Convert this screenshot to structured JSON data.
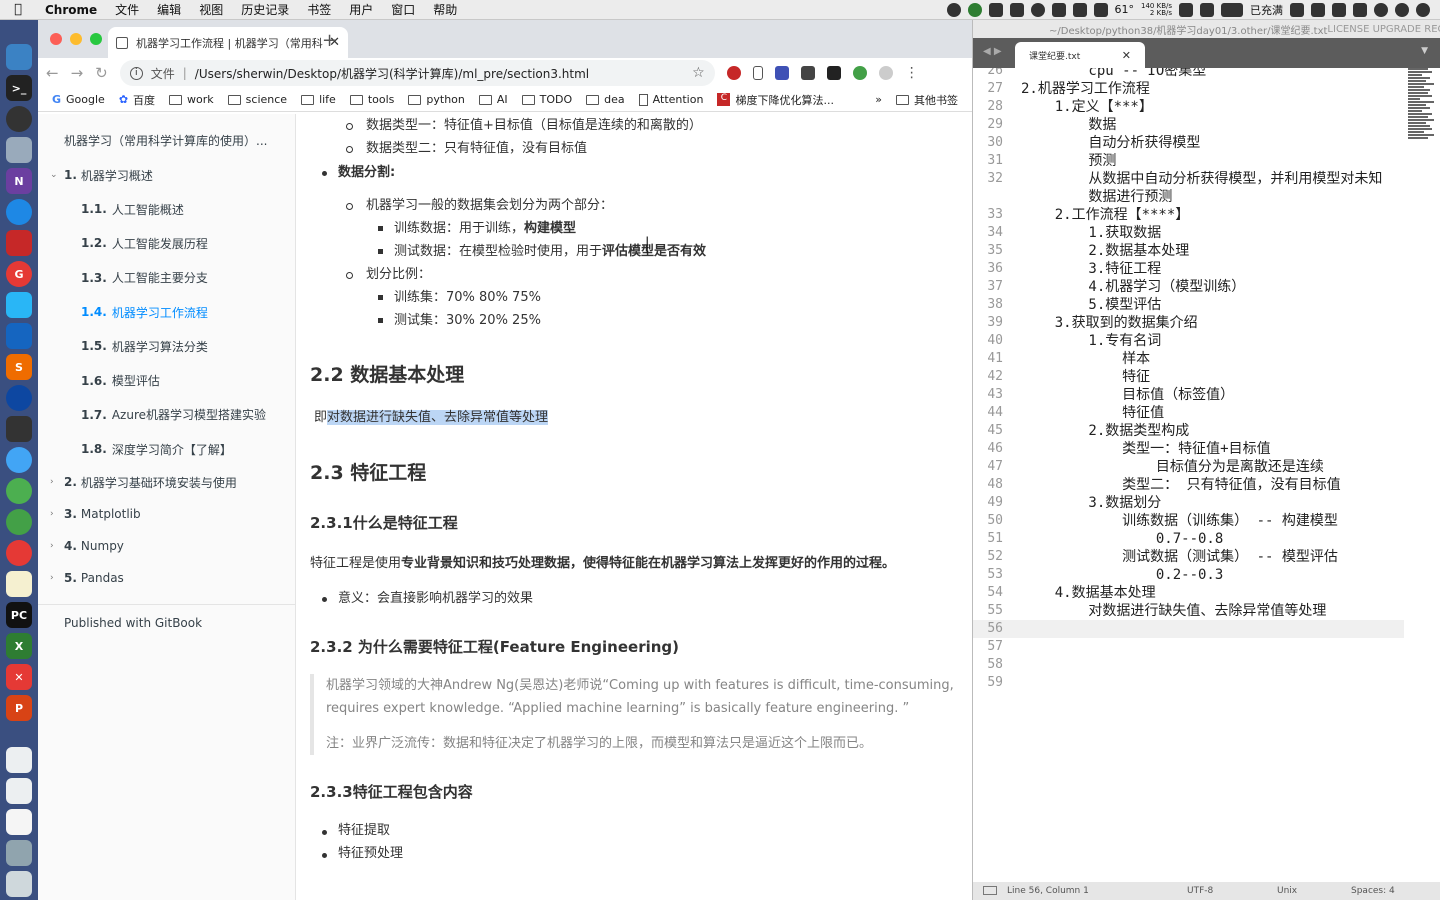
{
  "menubar": {
    "app": "Chrome",
    "items": [
      "文件",
      "编辑",
      "视图",
      "历史记录",
      "书签",
      "用户",
      "窗口",
      "帮助"
    ],
    "temp": "61°",
    "net_up": "140 KB/s",
    "net_down": "2 KB/s",
    "battery": "已充满"
  },
  "browser": {
    "tab_title": "机器学习工作流程 | 机器学习（常用科学计算库的使用）",
    "scheme_label": "文件",
    "url": "/Users/sherwin/Desktop/机器学习(科学计算库)/ml_pre/section3.html",
    "bookmarks": [
      "Google",
      "百度",
      "work",
      "science",
      "life",
      "tools",
      "python",
      "AI",
      "TODO",
      "dea",
      "Attention",
      "梯度下降优化算法..."
    ],
    "bookmarks_more": "»",
    "other_bookmarks": "其他书签"
  },
  "sidebar": {
    "book_title": "机器学习（常用科学计算库的使用）...",
    "chapter1": {
      "num": "1.",
      "label": "机器学习概述"
    },
    "subs": [
      {
        "num": "1.1.",
        "label": "人工智能概述"
      },
      {
        "num": "1.2.",
        "label": "人工智能发展历程"
      },
      {
        "num": "1.3.",
        "label": "人工智能主要分支"
      },
      {
        "num": "1.4.",
        "label": "机器学习工作流程"
      },
      {
        "num": "1.5.",
        "label": "机器学习算法分类"
      },
      {
        "num": "1.6.",
        "label": "模型评估"
      },
      {
        "num": "1.7.",
        "label": "Azure机器学习模型搭建实验"
      },
      {
        "num": "1.8.",
        "label": "深度学习简介【了解】"
      }
    ],
    "chapters": [
      {
        "num": "2.",
        "label": "机器学习基础环境安装与使用"
      },
      {
        "num": "3.",
        "label": "Matplotlib"
      },
      {
        "num": "4.",
        "label": "Numpy"
      },
      {
        "num": "5.",
        "label": "Pandas"
      }
    ],
    "published": "Published with GitBook"
  },
  "content": {
    "type1": "数据类型一：特征值+目标值（目标值是连续的和离散的）",
    "type2": "数据类型二：只有特征值，没有目标值",
    "split_title": "数据分割:",
    "split_desc": "机器学习一般的数据集会划分为两个部分：",
    "train_prefix": "训练数据：用于训练，",
    "train_bold": "构建模型",
    "test_prefix": "测试数据：在模型检验时使用，用于",
    "test_bold": "评估模型是否有效",
    "ratio_title": "划分比例：",
    "train_ratio": "训练集：70% 80% 75%",
    "test_ratio": "测试集：30% 20% 25%",
    "h_22": "2.2 数据基本处理",
    "p_22_prefix": "即",
    "p_22_hl": "对数据进行缺失值、去除异常值等处理",
    "h_23": "2.3 特征工程",
    "h_231": "2.3.1什么是特征工程",
    "fe_prefix": "特征工程是使用",
    "fe_bold": "专业背景知识和技巧处理数据，使得特征能在机器学习算法上发挥更好的作用的过程。",
    "meaning": "意义：会直接影响机器学习的效果",
    "h_232": "2.3.2 为什么需要特征工程(Feature Engineering)",
    "quote1": "机器学习领域的大神Andrew Ng(吴恩达)老师说“Coming up with features is difficult, time-consuming, requires expert knowledge. “Applied machine learning” is basically feature engineering. ”",
    "quote2": "注：业界广泛流传：数据和特征决定了机器学习的上限，而模型和算法只是逼近这个上限而已。",
    "h_233": "2.3.3特征工程包含内容",
    "item1": "特征提取",
    "item2": "特征预处理"
  },
  "editor": {
    "title": "~/Desktop/python38/机器学习day01/3.other/课堂纪要.txt",
    "license": "LICENSE UPGRADE REQUIRED",
    "tab": "课堂纪要.txt",
    "lines": [
      {
        "n": "26",
        "t": "        cpu -- IO密集型"
      },
      {
        "n": "27",
        "t": "2.机器学习工作流程"
      },
      {
        "n": "28",
        "t": "    1.定义【***】"
      },
      {
        "n": "29",
        "t": "        数据"
      },
      {
        "n": "30",
        "t": "        自动分析获得模型"
      },
      {
        "n": "31",
        "t": "        预测"
      },
      {
        "n": "32",
        "t": "        从数据中自动分析获得模型，并利用模型对未知"
      },
      {
        "n": "",
        "t": "        数据进行预测"
      },
      {
        "n": "33",
        "t": "    2.工作流程【****】"
      },
      {
        "n": "34",
        "t": "        1.获取数据"
      },
      {
        "n": "35",
        "t": "        2.数据基本处理"
      },
      {
        "n": "36",
        "t": "        3.特征工程"
      },
      {
        "n": "37",
        "t": "        4.机器学习（模型训练）"
      },
      {
        "n": "38",
        "t": "        5.模型评估"
      },
      {
        "n": "39",
        "t": "    3.获取到的数据集介绍"
      },
      {
        "n": "40",
        "t": "        1.专有名词"
      },
      {
        "n": "41",
        "t": "            样本"
      },
      {
        "n": "42",
        "t": "            特征"
      },
      {
        "n": "43",
        "t": "            目标值（标签值）"
      },
      {
        "n": "44",
        "t": "            特征值"
      },
      {
        "n": "45",
        "t": "        2.数据类型构成"
      },
      {
        "n": "46",
        "t": "            类型一：特征值+目标值"
      },
      {
        "n": "47",
        "t": "                目标值分为是离散还是连续"
      },
      {
        "n": "48",
        "t": "            类型二： 只有特征值，没有目标值"
      },
      {
        "n": "49",
        "t": "        3.数据划分"
      },
      {
        "n": "50",
        "t": "            训练数据（训练集） -- 构建模型"
      },
      {
        "n": "51",
        "t": "                0.7--0.8"
      },
      {
        "n": "52",
        "t": "            测试数据（测试集） -- 模型评估"
      },
      {
        "n": "53",
        "t": "                0.2--0.3"
      },
      {
        "n": "54",
        "t": "    4.数据基本处理"
      },
      {
        "n": "55",
        "t": "        对数据进行缺失值、去除异常值等处理"
      },
      {
        "n": "56",
        "t": ""
      },
      {
        "n": "57",
        "t": ""
      },
      {
        "n": "58",
        "t": ""
      },
      {
        "n": "59",
        "t": ""
      }
    ],
    "status_pos": "Line 56, Column 1",
    "status_enc": "UTF-8",
    "status_eol": "Unix",
    "status_spaces": "Spaces: 4"
  }
}
